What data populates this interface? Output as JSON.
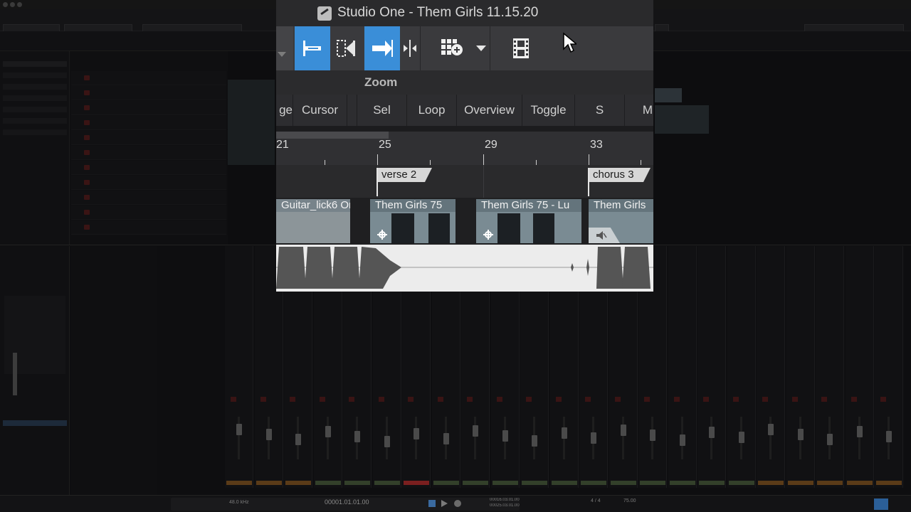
{
  "popup": {
    "window_title": "Studio One - Them Girls 11.15.20",
    "zoom_section_label": "Zoom",
    "zoom_buttons": [
      "ge",
      "Cursor",
      "Sel",
      "Loop",
      "Overview",
      "Toggle",
      "S",
      "M"
    ],
    "ruler": [
      "21",
      "25",
      "29",
      "33"
    ],
    "markers": [
      {
        "label": "verse 2"
      },
      {
        "label": "chorus 3"
      }
    ],
    "events": [
      {
        "label": "Guitar_lick6 Or"
      },
      {
        "label": "Them Girls 75"
      },
      {
        "label": "Them Girls 75 - Lu"
      },
      {
        "label": "Them Girls"
      }
    ],
    "tools": [
      {
        "name": "range-tool-icon",
        "active": true
      },
      {
        "name": "split-tool-icon",
        "active": false
      },
      {
        "name": "follow-arrow-icon",
        "active": true
      },
      {
        "name": "split-cursor-icon",
        "active": false
      },
      {
        "name": "add-grid-icon",
        "active": false
      },
      {
        "name": "dropdown-arrow-icon",
        "active": false
      },
      {
        "name": "film-strip-icon",
        "active": false
      }
    ]
  },
  "background": {
    "transport_position": "00001.01.01.00",
    "left_locator": "00016.03.01.00",
    "right_locator": "00025.03.01.00",
    "tempo": "75.00",
    "sample_rate": "48.0 kHz",
    "time_signature": "4 / 4"
  },
  "colors": {
    "accent_blue": "#3a8ed8",
    "marker_fill": "#d7d7d7",
    "event_fill": "#7a8b93",
    "mute_red": "#b52b2b"
  }
}
